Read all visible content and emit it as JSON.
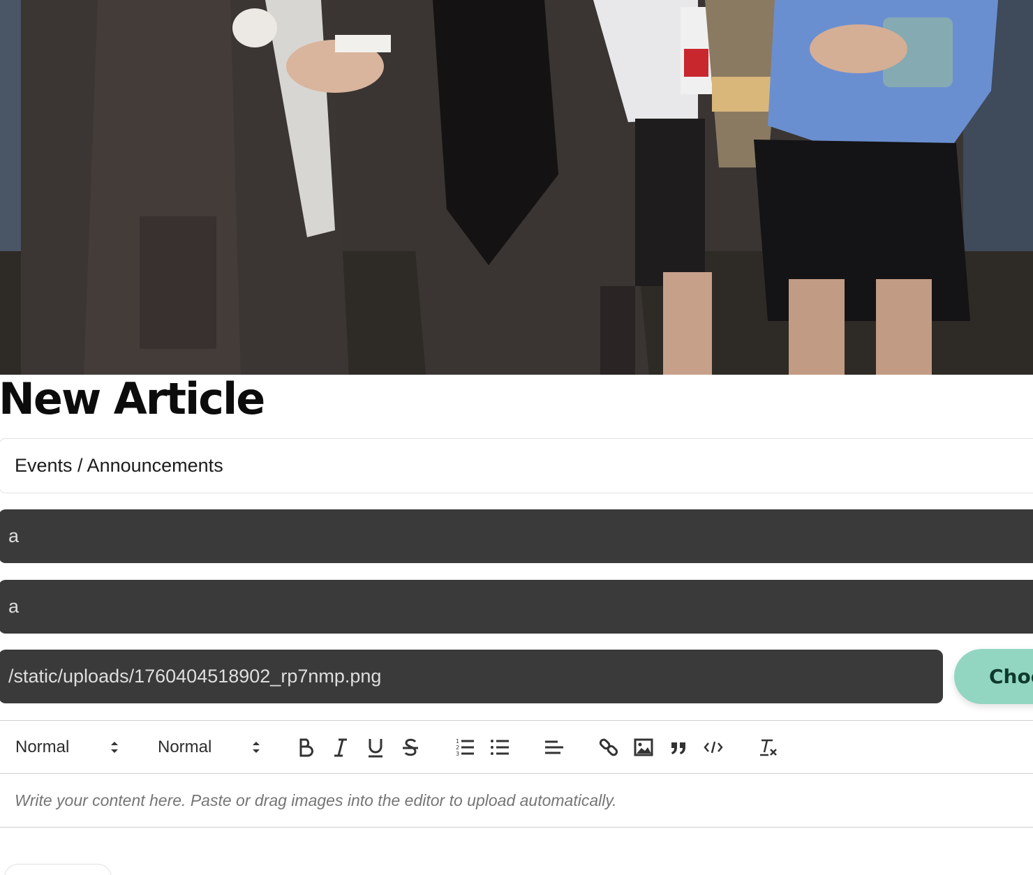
{
  "page": {
    "title": "New Article"
  },
  "form": {
    "category_value": "Events / Announcements",
    "field_1_value": "a",
    "field_2_value": "a",
    "image_path_value": "/static/uploads/1760404518902_rp7nmp.png",
    "choose_button_label": "Choose"
  },
  "editor": {
    "toolbar": {
      "header_select_value": "Normal",
      "size_select_value": "Normal",
      "buttons": [
        "bold-icon",
        "italic-icon",
        "underline-icon",
        "strikethrough-icon",
        "ordered-list-icon",
        "bullet-list-icon",
        "align-icon",
        "link-icon",
        "image-icon",
        "blockquote-icon",
        "code-block-icon",
        "clear-format-icon"
      ]
    },
    "placeholder": "Write your content here. Paste or drag images into the editor to upload automatically."
  },
  "colors": {
    "dark_input_bg": "#3a3a3a",
    "accent_button": "#92d6c1",
    "accent_button_text": "#0e3a2e"
  }
}
